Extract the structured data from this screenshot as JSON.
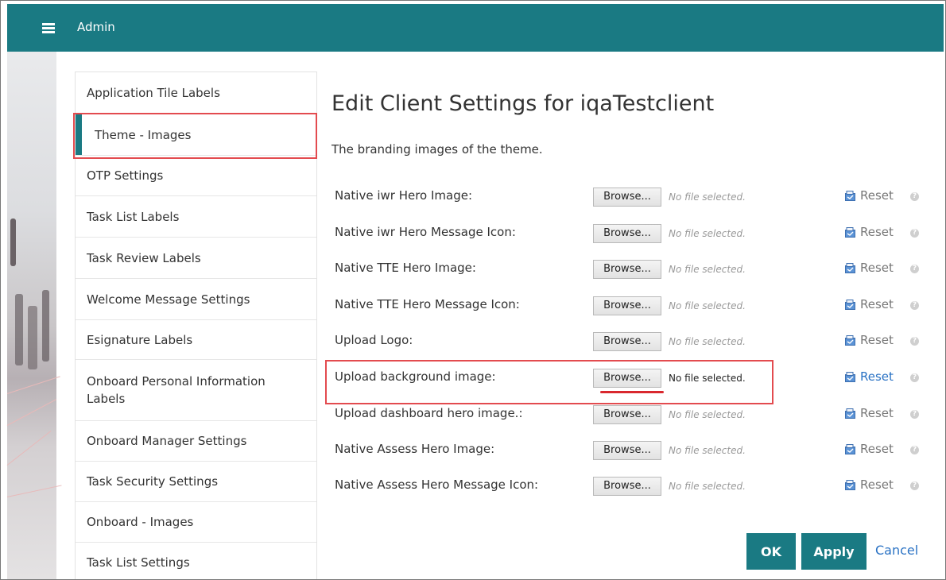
{
  "header": {
    "title": "Admin",
    "menu_icon": "hamburger-icon"
  },
  "sidebar": {
    "selected_index": 1,
    "items": [
      {
        "label": "Application Tile Labels"
      },
      {
        "label": "Theme - Images"
      },
      {
        "label": "OTP Settings"
      },
      {
        "label": "Task List Labels"
      },
      {
        "label": "Task Review Labels"
      },
      {
        "label": "Welcome Message Settings"
      },
      {
        "label": "Esignature Labels"
      },
      {
        "label": "Onboard Personal Information Labels"
      },
      {
        "label": "Onboard Manager Settings"
      },
      {
        "label": "Task Security Settings"
      },
      {
        "label": "Onboard - Images"
      },
      {
        "label": "Task List Settings"
      }
    ]
  },
  "main": {
    "title": "Edit Client Settings for iqaTestclient",
    "subtitle": "The branding images of the theme.",
    "browse_label": "Browse...",
    "reset_label": "Reset",
    "help_glyph": "?",
    "rows": [
      {
        "label": "Native iwr Hero Image:",
        "status": "No file selected."
      },
      {
        "label": "Native iwr Hero Message Icon:",
        "status": "No file selected."
      },
      {
        "label": "Native TTE Hero Image:",
        "status": "No file selected."
      },
      {
        "label": "Native TTE Hero Message Icon:",
        "status": "No file selected."
      },
      {
        "label": "Upload Logo:",
        "status": "No file selected."
      },
      {
        "label": "Upload background image:",
        "status": "No file selected."
      },
      {
        "label": "Upload dashboard hero image.:",
        "status": "No file selected."
      },
      {
        "label": "Native Assess Hero Image:",
        "status": "No file selected."
      },
      {
        "label": "Native Assess Hero Message Icon:",
        "status": "No file selected."
      }
    ]
  },
  "footer": {
    "ok_label": "OK",
    "apply_label": "Apply",
    "cancel_label": "Cancel"
  },
  "colors": {
    "header": "#1a7a83",
    "accent": "#1a7a83",
    "link": "#2a72c4",
    "highlight": "#e34b4f"
  }
}
